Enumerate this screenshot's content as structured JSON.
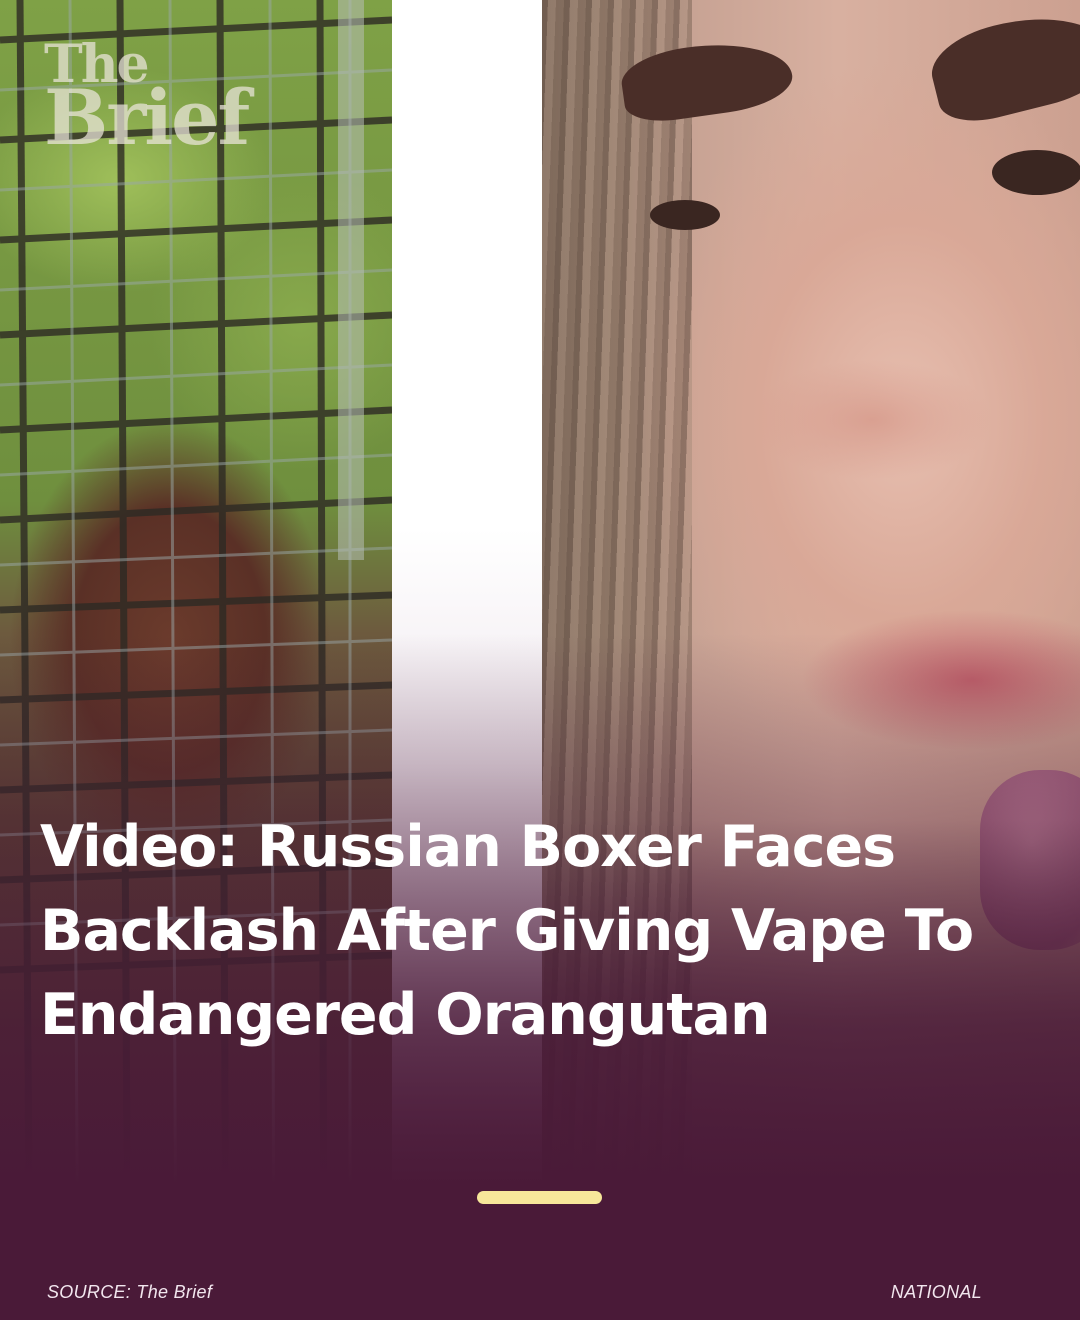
{
  "logo": {
    "line1": "The",
    "line2": "Brief"
  },
  "headline": "Video: Russian Boxer Faces Backlash After Giving Vape To Endangered Orangutan",
  "footer": {
    "source": "SOURCE: The Brief",
    "category": "NATIONAL"
  },
  "colors": {
    "background": "#4a1a38",
    "headline": "#ffffff",
    "indicator": "#f7e79a",
    "footer_text": "#f2e6ee"
  },
  "carousel": {
    "active_index": 0
  }
}
